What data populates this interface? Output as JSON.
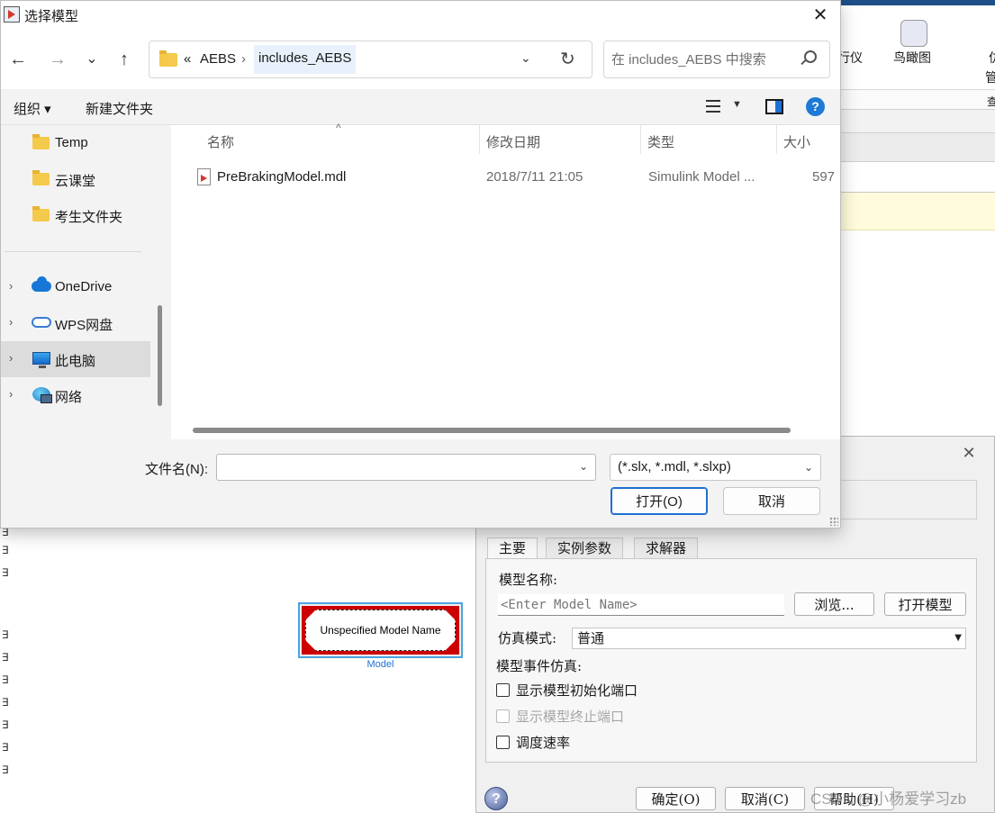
{
  "dialog": {
    "title": "选择模型",
    "nav": {
      "back": "←",
      "forward": "→",
      "recent": "⌄",
      "up": "↑"
    },
    "address": {
      "overflow": "«",
      "crumbs": [
        "AEBS",
        "includes_AEBS"
      ],
      "separator": "›"
    },
    "search_placeholder": "在 includes_AEBS 中搜索",
    "commands": {
      "organize": "组织 ▾",
      "new_folder": "新建文件夹"
    },
    "nav_pane": {
      "quick_access": [
        "Temp",
        "云课堂",
        "考生文件夹"
      ],
      "locations": [
        "OneDrive",
        "WPS网盘",
        "此电脑",
        "网络"
      ],
      "selected": "此电脑"
    },
    "columns": [
      "名称",
      "修改日期",
      "类型",
      "大小"
    ],
    "files": [
      {
        "name": "PreBrakingModel.mdl",
        "modified": "2018/7/11 21:05",
        "type": "Simulink Model ...",
        "size": "597"
      }
    ],
    "filename_label": "文件名(N):",
    "filename_value": "",
    "filetype": "(*.slx, *.mdl, *.slxp)",
    "open_label": "打开(O)",
    "cancel_label": "取消"
  },
  "background_app": {
    "toolbar_partial_label": "行仪",
    "birdseye_label": "鸟瞰图",
    "partial_1": "仿",
    "partial_2": "管",
    "partial_3": "查",
    "model_block": {
      "text": "Unspecified Model Name",
      "caption": "Model"
    },
    "left_marks": [
      "∃",
      "∃",
      "∃",
      "∃",
      "∃",
      "∃",
      "∃",
      "∃",
      "∃",
      "∃",
      "∃"
    ]
  },
  "param_dialog": {
    "tabs": [
      "主要",
      "实例参数",
      "求解器"
    ],
    "model_name_label": "模型名称:",
    "model_name_placeholder": "<Enter Model Name>",
    "browse_label": "浏览...",
    "open_model_label": "打开模型",
    "sim_mode_label": "仿真模式:",
    "sim_mode_value": "普通",
    "event_sim_label": "模型事件仿真:",
    "checkboxes": [
      {
        "label": "显示模型初始化端口",
        "enabled": true
      },
      {
        "label": "显示模型终止端口",
        "enabled": false
      },
      {
        "label": "调度速率",
        "enabled": true
      }
    ],
    "ok_label": "确定(O)",
    "cancel_label": "取消(C)",
    "help_label": "帮助(H)"
  },
  "watermark": "CSDN @小杨爱学习zb"
}
